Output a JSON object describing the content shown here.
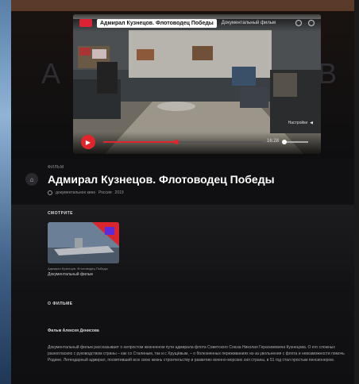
{
  "video": {
    "title": "Адмирал Кузнецов. Флотоводец Победы",
    "subtitle": "Документальный фильм",
    "time": "16:28",
    "quality_label": "Настройки",
    "progress": 0.46,
    "volume": 0.0
  },
  "hero": {
    "letter_left": "А",
    "letter_right": "В"
  },
  "page": {
    "tag": "ФИЛЬМ",
    "title": "Адмирал Кузнецов. Флотоводец Победы",
    "meta": [
      "документальное кино",
      "Россия",
      "2019"
    ]
  },
  "watch": {
    "heading": "СМОТРИТЕ",
    "item_caption": "Адмирал Кузнецов. Флотоводец Победы",
    "item_subtitle": "Документальный фильм"
  },
  "about": {
    "heading": "О ФИЛЬМЕ",
    "film_by": "Фильм Алексея Денисова",
    "description": "Документальный фильм рассказывает о непростом жизненном пути адмирала флота Советского Союза Николая Герасимовича Кузнецова. О его сложных разногласиях с руководством страны – как со Сталиным, так и с Хрущёвым, – о болезненных переживаниях из-за увольнения с флота и невозможности помочь Родине. Легендарный адмирал, посвятивший всю свою жизнь строительству и развитию военно-морских сил страны, в 51 год стал простым пенсионером."
  },
  "colors": {
    "accent": "#e0262c",
    "background": "#101012"
  }
}
